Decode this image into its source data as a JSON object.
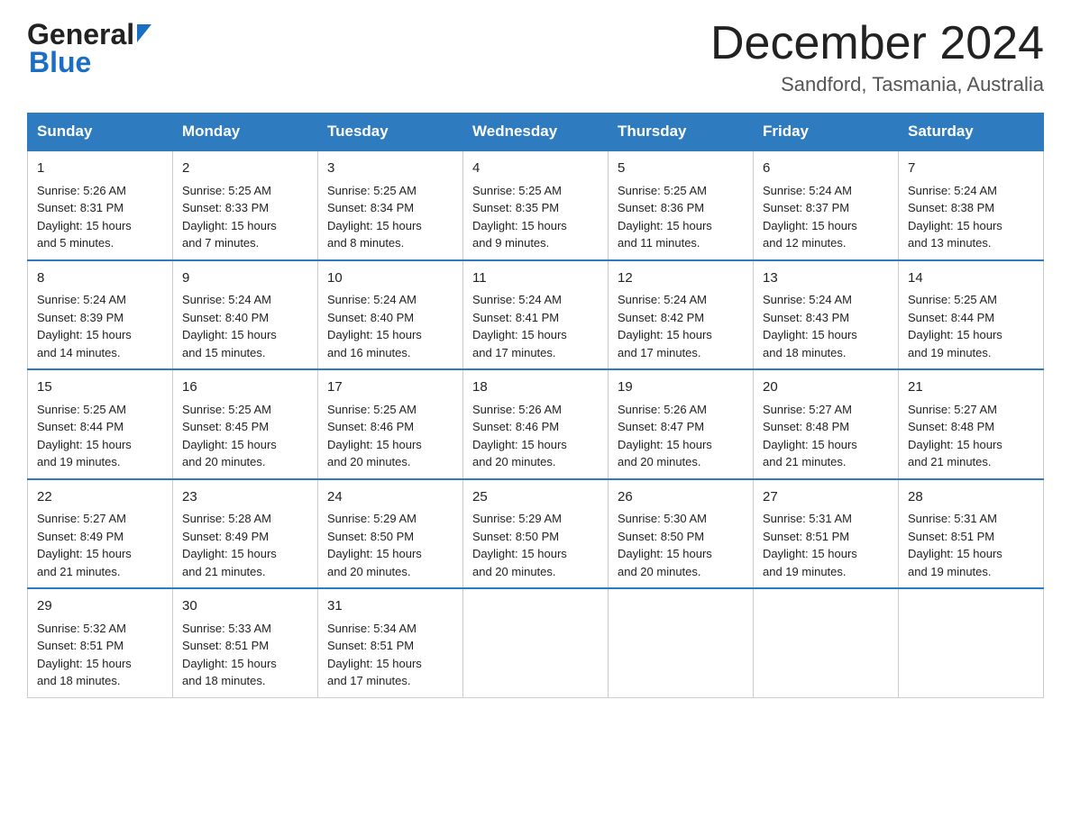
{
  "header": {
    "logo_general": "General",
    "logo_blue": "Blue",
    "month_title": "December 2024",
    "location": "Sandford, Tasmania, Australia"
  },
  "weekdays": [
    "Sunday",
    "Monday",
    "Tuesday",
    "Wednesday",
    "Thursday",
    "Friday",
    "Saturday"
  ],
  "weeks": [
    [
      {
        "day": "1",
        "sunrise": "5:26 AM",
        "sunset": "8:31 PM",
        "daylight": "15 hours and 5 minutes."
      },
      {
        "day": "2",
        "sunrise": "5:25 AM",
        "sunset": "8:33 PM",
        "daylight": "15 hours and 7 minutes."
      },
      {
        "day": "3",
        "sunrise": "5:25 AM",
        "sunset": "8:34 PM",
        "daylight": "15 hours and 8 minutes."
      },
      {
        "day": "4",
        "sunrise": "5:25 AM",
        "sunset": "8:35 PM",
        "daylight": "15 hours and 9 minutes."
      },
      {
        "day": "5",
        "sunrise": "5:25 AM",
        "sunset": "8:36 PM",
        "daylight": "15 hours and 11 minutes."
      },
      {
        "day": "6",
        "sunrise": "5:24 AM",
        "sunset": "8:37 PM",
        "daylight": "15 hours and 12 minutes."
      },
      {
        "day": "7",
        "sunrise": "5:24 AM",
        "sunset": "8:38 PM",
        "daylight": "15 hours and 13 minutes."
      }
    ],
    [
      {
        "day": "8",
        "sunrise": "5:24 AM",
        "sunset": "8:39 PM",
        "daylight": "15 hours and 14 minutes."
      },
      {
        "day": "9",
        "sunrise": "5:24 AM",
        "sunset": "8:40 PM",
        "daylight": "15 hours and 15 minutes."
      },
      {
        "day": "10",
        "sunrise": "5:24 AM",
        "sunset": "8:40 PM",
        "daylight": "15 hours and 16 minutes."
      },
      {
        "day": "11",
        "sunrise": "5:24 AM",
        "sunset": "8:41 PM",
        "daylight": "15 hours and 17 minutes."
      },
      {
        "day": "12",
        "sunrise": "5:24 AM",
        "sunset": "8:42 PM",
        "daylight": "15 hours and 17 minutes."
      },
      {
        "day": "13",
        "sunrise": "5:24 AM",
        "sunset": "8:43 PM",
        "daylight": "15 hours and 18 minutes."
      },
      {
        "day": "14",
        "sunrise": "5:25 AM",
        "sunset": "8:44 PM",
        "daylight": "15 hours and 19 minutes."
      }
    ],
    [
      {
        "day": "15",
        "sunrise": "5:25 AM",
        "sunset": "8:44 PM",
        "daylight": "15 hours and 19 minutes."
      },
      {
        "day": "16",
        "sunrise": "5:25 AM",
        "sunset": "8:45 PM",
        "daylight": "15 hours and 20 minutes."
      },
      {
        "day": "17",
        "sunrise": "5:25 AM",
        "sunset": "8:46 PM",
        "daylight": "15 hours and 20 minutes."
      },
      {
        "day": "18",
        "sunrise": "5:26 AM",
        "sunset": "8:46 PM",
        "daylight": "15 hours and 20 minutes."
      },
      {
        "day": "19",
        "sunrise": "5:26 AM",
        "sunset": "8:47 PM",
        "daylight": "15 hours and 20 minutes."
      },
      {
        "day": "20",
        "sunrise": "5:27 AM",
        "sunset": "8:48 PM",
        "daylight": "15 hours and 21 minutes."
      },
      {
        "day": "21",
        "sunrise": "5:27 AM",
        "sunset": "8:48 PM",
        "daylight": "15 hours and 21 minutes."
      }
    ],
    [
      {
        "day": "22",
        "sunrise": "5:27 AM",
        "sunset": "8:49 PM",
        "daylight": "15 hours and 21 minutes."
      },
      {
        "day": "23",
        "sunrise": "5:28 AM",
        "sunset": "8:49 PM",
        "daylight": "15 hours and 21 minutes."
      },
      {
        "day": "24",
        "sunrise": "5:29 AM",
        "sunset": "8:50 PM",
        "daylight": "15 hours and 20 minutes."
      },
      {
        "day": "25",
        "sunrise": "5:29 AM",
        "sunset": "8:50 PM",
        "daylight": "15 hours and 20 minutes."
      },
      {
        "day": "26",
        "sunrise": "5:30 AM",
        "sunset": "8:50 PM",
        "daylight": "15 hours and 20 minutes."
      },
      {
        "day": "27",
        "sunrise": "5:31 AM",
        "sunset": "8:51 PM",
        "daylight": "15 hours and 19 minutes."
      },
      {
        "day": "28",
        "sunrise": "5:31 AM",
        "sunset": "8:51 PM",
        "daylight": "15 hours and 19 minutes."
      }
    ],
    [
      {
        "day": "29",
        "sunrise": "5:32 AM",
        "sunset": "8:51 PM",
        "daylight": "15 hours and 18 minutes."
      },
      {
        "day": "30",
        "sunrise": "5:33 AM",
        "sunset": "8:51 PM",
        "daylight": "15 hours and 18 minutes."
      },
      {
        "day": "31",
        "sunrise": "5:34 AM",
        "sunset": "8:51 PM",
        "daylight": "15 hours and 17 minutes."
      },
      null,
      null,
      null,
      null
    ]
  ],
  "labels": {
    "sunrise": "Sunrise:",
    "sunset": "Sunset:",
    "daylight": "Daylight:"
  }
}
